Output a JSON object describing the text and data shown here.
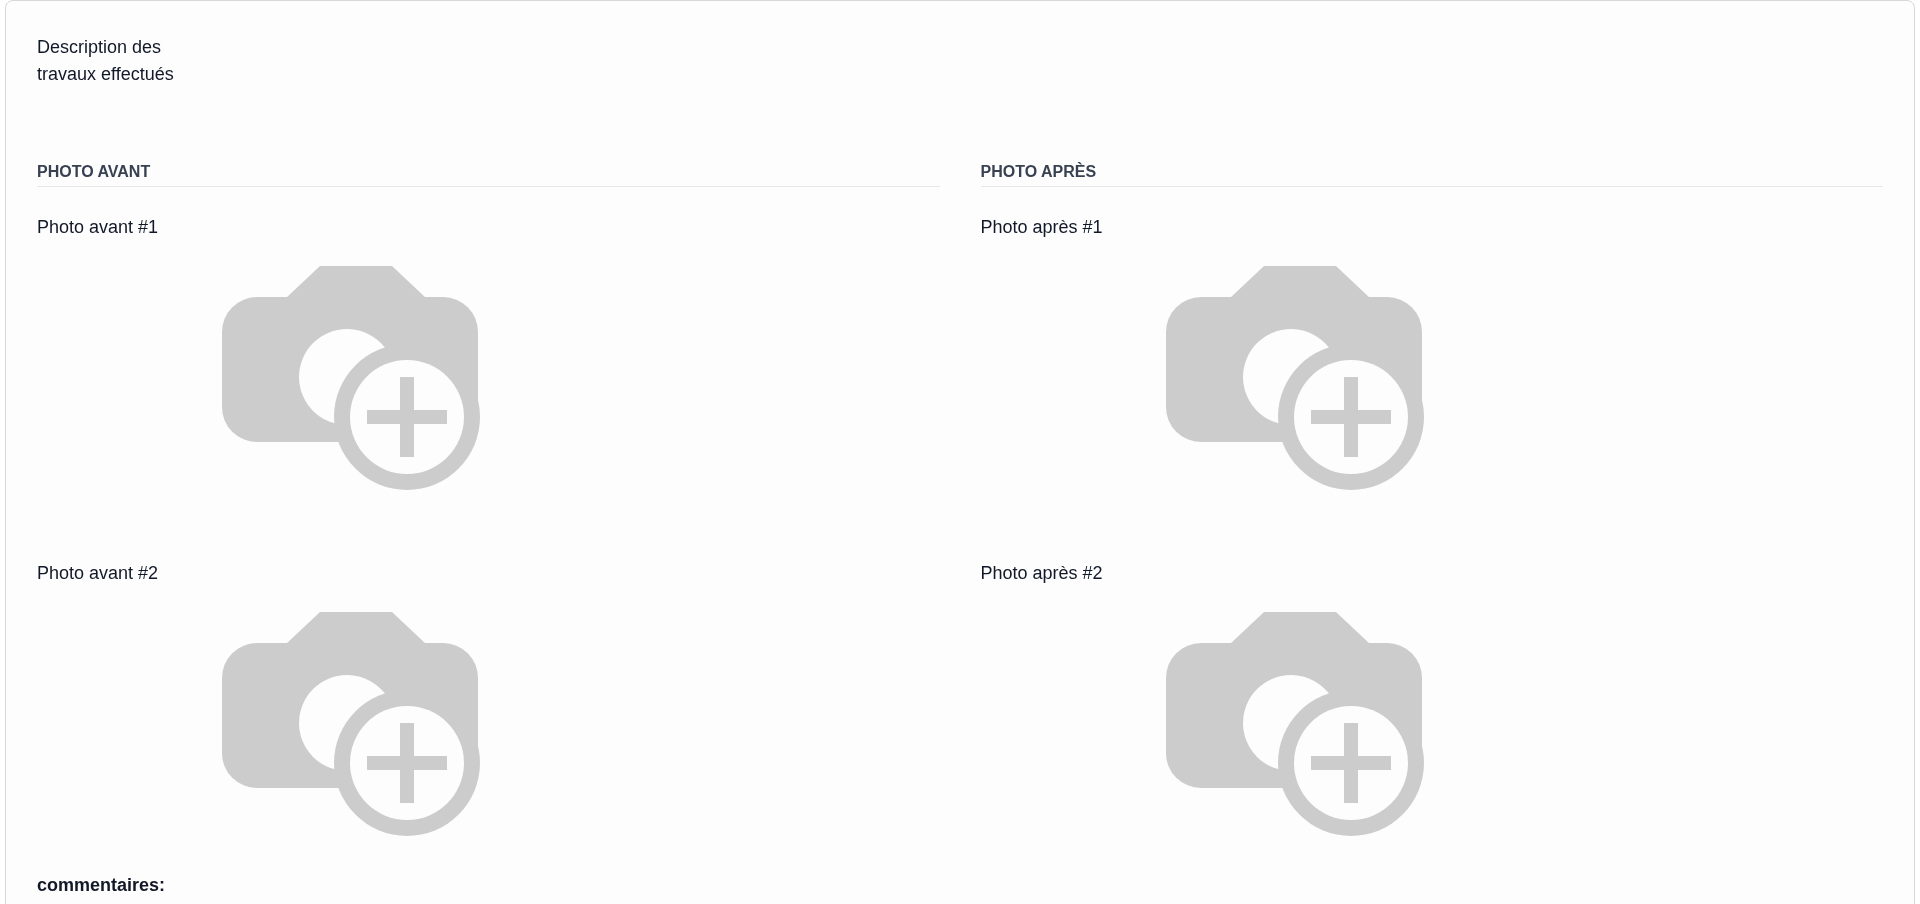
{
  "description_label": "Description des travaux effectués",
  "columns": [
    {
      "heading": "PHOTO AVANT",
      "photos": [
        {
          "label": "Photo avant #1"
        },
        {
          "label": "Photo avant #2"
        }
      ]
    },
    {
      "heading": "PHOTO APRÈS",
      "photos": [
        {
          "label": "Photo après #1"
        },
        {
          "label": "Photo après #2"
        }
      ]
    }
  ],
  "comments_label": "commentaires:"
}
